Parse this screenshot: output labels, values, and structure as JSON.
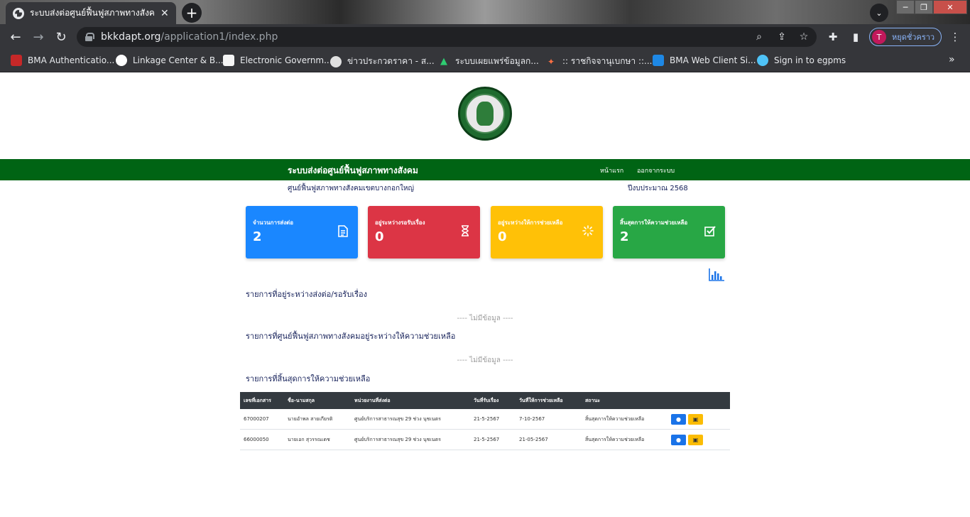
{
  "browser": {
    "tab_title": "ระบบส่งต่อศูนย์ฟื้นฟูสภาพทางสังคม",
    "url_host": "bkkdapt.org",
    "url_path": "/application1/index.php",
    "profile_initial": "T",
    "profile_label": "หยุดชั่วคราว",
    "bookmarks": [
      "BMA Authenticatio...",
      "Linkage Center & B...",
      "Electronic Governm...",
      "ข่าวประกวดราคา - ส...",
      "ระบบเผยแพร่ข้อมูลก...",
      ":: ราชกิจจานุเบกษา ::...",
      "BMA Web Client Si...",
      "Sign in to egpms"
    ]
  },
  "navbar": {
    "brand": "ระบบส่งต่อศูนย์ฟื้นฟูสภาพทางสังคม",
    "home": "หน้าแรก",
    "logout": "ออกจากระบบ"
  },
  "info": {
    "center_name": "ศูนย์ฟื้นฟูสภาพทางสังคมเขตบางกอกใหญ่",
    "fiscal_year": "ปีงบประมาณ 2568"
  },
  "cards": [
    {
      "label": "จำนวนการส่งต่อ",
      "value": "2",
      "color": "#1a87ff"
    },
    {
      "label": "อยู่ระหว่างรอรับเรื่อง",
      "value": "0",
      "color": "#dc3545"
    },
    {
      "label": "อยู่ระหว่างให้การช่วยเหลือ",
      "value": "0",
      "color": "#ffc107"
    },
    {
      "label": "สิ้นสุดการให้ความช่วยเหลือ",
      "value": "2",
      "color": "#28a745"
    }
  ],
  "sections": {
    "pending_title": "รายการที่อยู่ระหว่างส่งต่อ/รอรับเรื่อง",
    "pending_empty": "---- ไม่มีข้อมูล ----",
    "assisting_title": "รายการที่ศูนย์ฟื้นฟูสภาพทางสังคมอยู่ระหว่างให้ความช่วยเหลือ",
    "assisting_empty": "---- ไม่มีข้อมูล ----",
    "finished_title": "รายการที่สิ้นสุดการให้ความช่วยเหลือ"
  },
  "table": {
    "headers": [
      "เลขที่เอกสาร",
      "ชื่อ-นามสกุล",
      "หน่วยงานที่ส่งต่อ",
      "วันที่รับเรื่อง",
      "วันที่ให้การช่วยเหลือ",
      "สถานะ"
    ],
    "rows": [
      [
        "67000207",
        "นายอำพล สายเกียรติ",
        "ศูนย์บริการสาธารณสุข 29 ช่วง นุชเนตร",
        "21-5-2567",
        "7-10-2567",
        "สิ้นสุดการให้ความช่วยเหลือ"
      ],
      [
        "66000050",
        "นายเอก สุวรรณเดช",
        "ศูนย์บริการสาธารณสุข 29 ช่วง นุชเนตร",
        "21-5-2567",
        "21-05-2567",
        "สิ้นสุดการให้ความช่วยเหลือ"
      ]
    ]
  }
}
